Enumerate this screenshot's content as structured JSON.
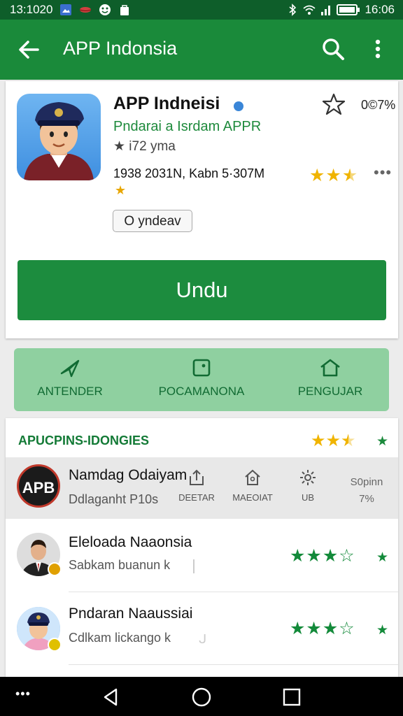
{
  "status_bar": {
    "time_left": "13:1020",
    "time_right": "16:06"
  },
  "app_bar": {
    "title": "APP Indonsia"
  },
  "app_card": {
    "name": "APP Indneisi",
    "developer": "Pndarai a Isrdam APPR",
    "rating_text": "★ i72 yma",
    "meta": "1938 2031N,  Kabn 5·307M",
    "wishlist_percent": "0©7%",
    "rating_stars": 2.5,
    "badge_label": "O yndeav",
    "install_label": "Undu"
  },
  "tabs": [
    {
      "label": "ANTENDER",
      "icon": "paper-plane-icon"
    },
    {
      "label": "POCAMANONA",
      "icon": "square-dot-icon"
    },
    {
      "label": "PENGUJAR",
      "icon": "home-icon"
    }
  ],
  "list_section": {
    "title": "APUCPINS-IDONGIES",
    "stars": 2.5,
    "items": [
      {
        "avatar_text": "APB",
        "title": "Namdag Odaiyam",
        "subtitle": "Ddlaganht  P10s",
        "actions": [
          {
            "label": "DEETAR",
            "icon": "share-icon"
          },
          {
            "label": "MAEOIAT",
            "icon": "home-icon"
          },
          {
            "label": "UB",
            "icon": "gear-icon"
          }
        ],
        "right_top": "S0pinn",
        "right_bottom": "7%"
      },
      {
        "title": "Eleloada Naaonsia",
        "subtitle": "Sabkam buanun k",
        "stars": 3
      },
      {
        "title": "Pndaran Naaussiai",
        "subtitle": "Cdlkam lickango k",
        "stars": 3
      }
    ]
  }
}
